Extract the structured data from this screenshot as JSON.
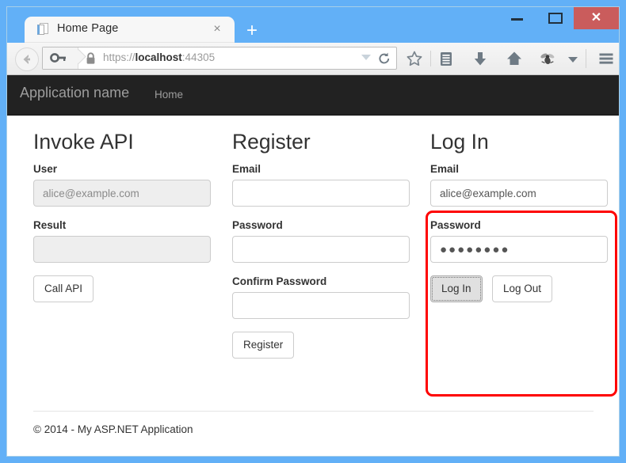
{
  "window": {
    "controls": {
      "minimize": "minimize",
      "maximize": "maximize",
      "close": "✕"
    }
  },
  "browser": {
    "tab": {
      "title": "Home Page",
      "close_label": "×"
    },
    "new_tab_label": "+",
    "url": {
      "scheme": "https://",
      "host": "localhost",
      "port": ":44305",
      "full": "https://localhost:44305"
    },
    "toolbar_icons": [
      "back-icon",
      "key-icon",
      "lock-icon",
      "url-dropdown-icon",
      "reload-icon",
      "bookmark-star-icon",
      "reader-list-icon",
      "download-arrow-icon",
      "home-icon",
      "firebug-fly-icon",
      "toolbar-dropdown-icon",
      "hamburger-menu-icon"
    ]
  },
  "page": {
    "navbar": {
      "brand": "Application name",
      "home_link": "Home"
    },
    "columns": {
      "invoke": {
        "heading": "Invoke API",
        "user_label": "User",
        "user_value": "alice@example.com",
        "result_label": "Result",
        "result_value": "",
        "call_button": "Call API"
      },
      "register": {
        "heading": "Register",
        "email_label": "Email",
        "email_value": "",
        "password_label": "Password",
        "password_value": "",
        "confirm_label": "Confirm Password",
        "confirm_value": "",
        "register_button": "Register"
      },
      "login": {
        "heading": "Log In",
        "email_label": "Email",
        "email_value": "alice@example.com",
        "password_label": "Password",
        "password_value": "●●●●●●●●",
        "login_button": "Log In",
        "logout_button": "Log Out",
        "highlight_color": "#fe0000"
      }
    },
    "footer": "© 2014 - My ASP.NET Application"
  }
}
